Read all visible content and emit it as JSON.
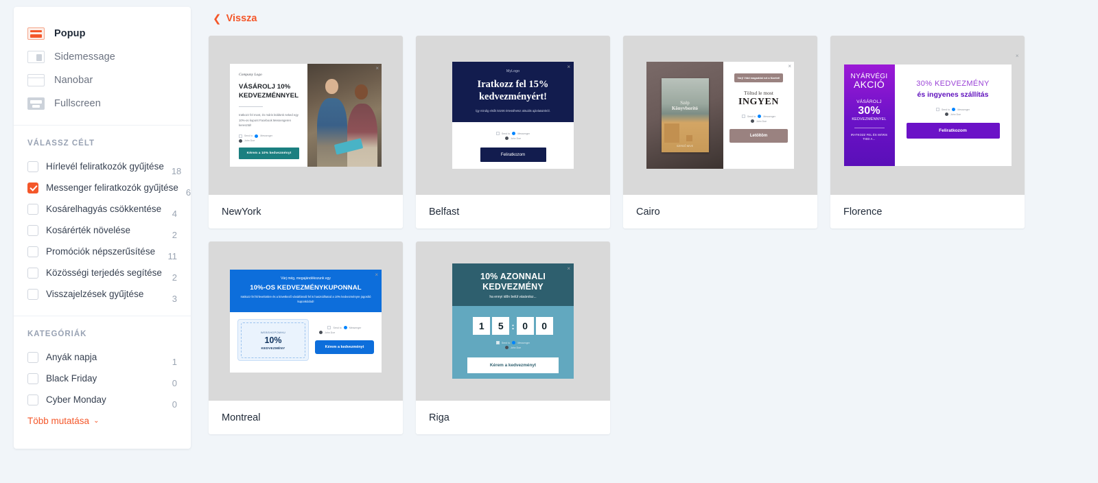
{
  "sidebar": {
    "types": [
      {
        "label": "Popup",
        "icon": "popup-icon",
        "active": true
      },
      {
        "label": "Sidemessage",
        "icon": "sidemessage-icon",
        "active": false
      },
      {
        "label": "Nanobar",
        "icon": "nanobar-icon",
        "active": false
      },
      {
        "label": "Fullscreen",
        "icon": "fullscreen-icon",
        "active": false
      }
    ],
    "goal_section": {
      "title": "VÁLASSZ CÉLT",
      "items": [
        {
          "label": "Hírlevél feliratkozók gyűjtése",
          "count": "18",
          "checked": false
        },
        {
          "label": "Messenger feliratkozók gyűjtése",
          "count": "6",
          "checked": true
        },
        {
          "label": "Kosárelhagyás csökkentése",
          "count": "4",
          "checked": false
        },
        {
          "label": "Kosárérték növelése",
          "count": "2",
          "checked": false
        },
        {
          "label": "Promóciók népszerűsítése",
          "count": "11",
          "checked": false
        },
        {
          "label": "Közösségi terjedés segítése",
          "count": "2",
          "checked": false
        },
        {
          "label": "Visszajelzések gyűjtése",
          "count": "3",
          "checked": false
        }
      ]
    },
    "category_section": {
      "title": "KATEGÓRIÁK",
      "items": [
        {
          "label": "Anyák napja",
          "count": "1",
          "checked": false
        },
        {
          "label": "Black Friday",
          "count": "0",
          "checked": false
        },
        {
          "label": "Cyber Monday",
          "count": "0",
          "checked": false
        }
      ],
      "show_more": "Több mutatása"
    },
    "accent_color": "#f4572a"
  },
  "main": {
    "back_label": "Vissza",
    "cards": [
      {
        "title": "NewYork"
      },
      {
        "title": "Belfast"
      },
      {
        "title": "Cairo"
      },
      {
        "title": "Florence"
      },
      {
        "title": "Montreal"
      },
      {
        "title": "Riga"
      }
    ]
  },
  "previews": {
    "newyork": {
      "logo": "Company Logo",
      "heading": "VÁSÁROLJ 10% KEDVEZMÉNNYEL",
      "body": "Iratkozz fel most, és máris küldünk neked egy 10%-os kupont Facebook Messengeren keresztül!",
      "button": "Kérem a 10% kedvezményt",
      "messenger_label": "Send to",
      "messenger_brand": "Messenger",
      "user": "John Doe"
    },
    "belfast": {
      "logo": "MyLogo",
      "heading": "Iratkozz fel 15% kedvezményért!",
      "body": "Így mindig elsők között értesülhetsz aktuális ajánlatainkról.",
      "button": "Feliratkozom",
      "messenger_label": "Send to",
      "messenger_brand": "Messenger",
      "user": "John Doe"
    },
    "cairo": {
      "book_line1": "Szép",
      "book_line2": "Könyvborító",
      "book_author": "SZERZŐ NEVE",
      "badge": "Várj! Vidd magaddal ezt a füzetet!",
      "sub": "Töltsd le most",
      "big": "INGYEN",
      "button": "Letöltöm",
      "messenger_label": "Send to",
      "messenger_brand": "Messenger",
      "user": "John Doe"
    },
    "florence": {
      "l1": "NYÁRVÉGI",
      "l2": "AKCIÓ",
      "l3": "VÁSÁROLJ",
      "l4": "30%",
      "l5": "KEDVEZMÉNNYEL",
      "l6": "IRATKOZZ FEL ÉS MÁRIS TIED A...",
      "h1": "30% KEDVEZMÉNY",
      "h2": "és ingyenes szállítás",
      "button": "Feliratkozom",
      "messenger_label": "Send to",
      "messenger_brand": "Messenger",
      "user": "John Doe"
    },
    "montreal": {
      "t1": "Várj még, megajándékozunk egy",
      "t2": "10%-OS KEDVEZMÉNYKUPONNAL",
      "t3": "Iratkozz fel hírlevelünkre és a következő vásárlásnál fel is használhatod a 10% kedvezményre jogosító kuponkódod!",
      "coupon_code": "WEBSHOPOMHU",
      "coupon_value": "10%",
      "coupon_label": "KEDVEZMÉNY",
      "button": "Kérem a kedvezményt",
      "messenger_label": "Send to",
      "messenger_brand": "Messenger",
      "user": "John Doe"
    },
    "riga": {
      "heading": "10% AZONNALI KEDVEZMÉNY",
      "sub": "ha ennyi időn belül vásárolsz...",
      "d1": "1",
      "d2": "5",
      "colon": ":",
      "d3": "0",
      "d4": "0",
      "button": "Kérem a kedvezményt",
      "messenger_label": "Send to",
      "messenger_brand": "Messenger",
      "user": "John Doe"
    }
  },
  "icons": {
    "close": "×",
    "chevron_down": "⌄",
    "chevron_left": "❮"
  }
}
